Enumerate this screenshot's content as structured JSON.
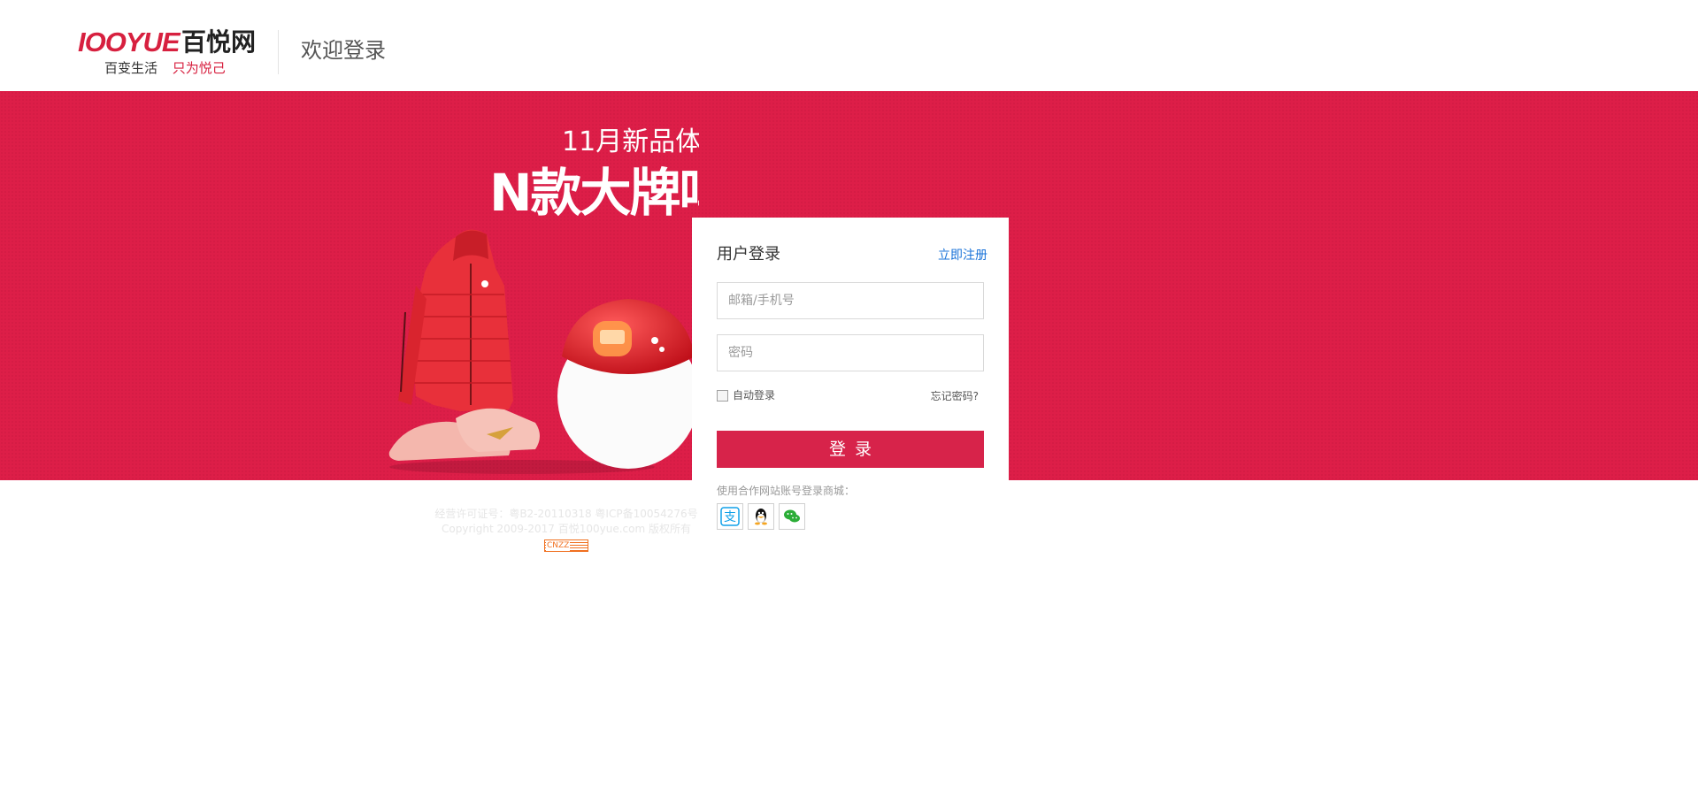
{
  "header": {
    "logo_wordmark": "IOOYUE",
    "logo_cn": "百悦网",
    "logo_slogan_left": "百变生活",
    "logo_slogan_right": "只为悦己",
    "welcome": "欢迎登录"
  },
  "banner": {
    "line1": "11月新品体",
    "line2": "N款大牌鸣"
  },
  "login": {
    "title": "用户登录",
    "register_link": "立即注册",
    "username_placeholder": "邮箱/手机号",
    "password_placeholder": "密码",
    "auto_login": "自动登录",
    "forgot_password": "忘记密码?",
    "submit_label": "登录",
    "partner_label": "使用合作网站账号登录商城：",
    "partners": [
      "alipay-icon",
      "qq-icon",
      "wechat-icon"
    ]
  },
  "footer": {
    "license": "经营许可证号：粤B2-20110318 粤ICP备10054276号",
    "copyright": "Copyright  2009-2017 百悦100yue.com 版权所有",
    "badge": "CNZZ"
  },
  "colors": {
    "brand_red": "#d7234a",
    "banner_red": "#dd1e48",
    "link_blue": "#1a73d9"
  }
}
